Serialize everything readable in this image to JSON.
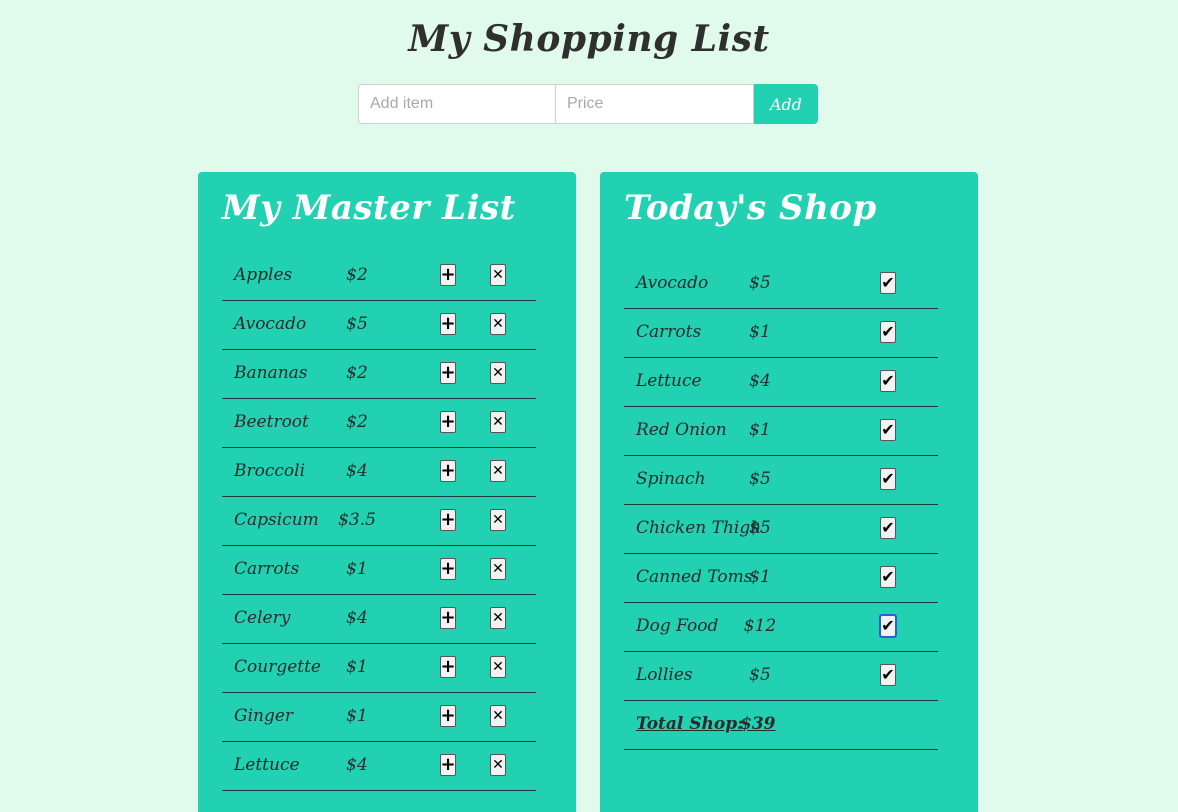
{
  "title": "My Shopping List",
  "form": {
    "item_placeholder": "Add item",
    "price_placeholder": "Price",
    "add_label": "Add"
  },
  "master": {
    "heading": "My Master List",
    "items": [
      {
        "name": "Apples",
        "price": "$2"
      },
      {
        "name": "Avocado",
        "price": "$5"
      },
      {
        "name": "Bananas",
        "price": "$2"
      },
      {
        "name": "Beetroot",
        "price": "$2"
      },
      {
        "name": "Broccoli",
        "price": "$4"
      },
      {
        "name": "Capsicum",
        "price": "$3.5"
      },
      {
        "name": "Carrots",
        "price": "$1"
      },
      {
        "name": "Celery",
        "price": "$4"
      },
      {
        "name": "Courgette",
        "price": "$1"
      },
      {
        "name": "Ginger",
        "price": "$1"
      },
      {
        "name": "Lettuce",
        "price": "$4"
      }
    ],
    "plus_icon": "plus-icon",
    "remove_icon": "close-icon"
  },
  "today": {
    "heading": "Today's Shop",
    "items": [
      {
        "name": "Avocado",
        "price": "$5"
      },
      {
        "name": "Carrots",
        "price": "$1"
      },
      {
        "name": "Lettuce",
        "price": "$4"
      },
      {
        "name": "Red Onion",
        "price": "$1"
      },
      {
        "name": "Spinach",
        "price": "$5"
      },
      {
        "name": "Chicken Thigh",
        "price": "$5"
      },
      {
        "name": "Canned Toms",
        "price": "$1"
      },
      {
        "name": "Dog Food",
        "price": "$12"
      },
      {
        "name": "Lollies",
        "price": "$5"
      }
    ],
    "total_label": "Total Shop:",
    "total_value": "$39",
    "check_icon": "checkmark-icon"
  },
  "colors": {
    "background": "#e0fbeb",
    "accent": "#22d1b2",
    "heading_text": "#ffffff"
  }
}
